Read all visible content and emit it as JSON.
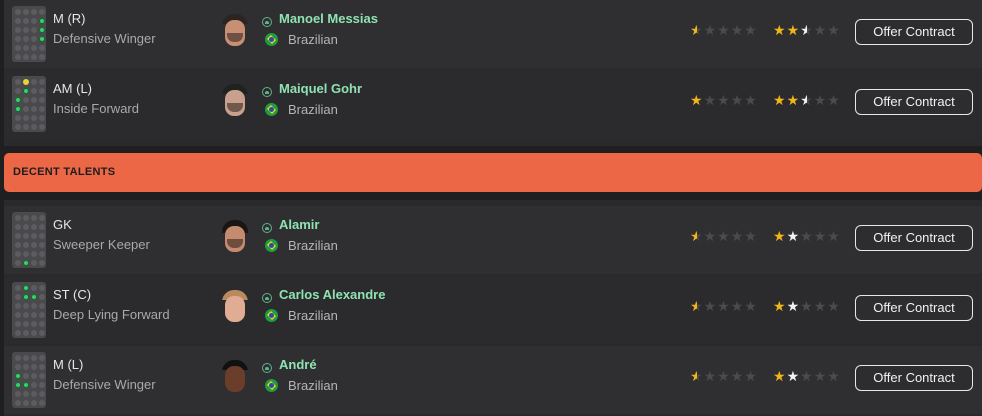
{
  "section_top_rows": [
    {
      "position": "M (R)",
      "role": "Defensive Winger",
      "name": "Manoel Messias",
      "nationality": "Brazilian",
      "current_ability_stars": 0.5,
      "potential_ability_stars": 2.5,
      "button": "Offer Contract"
    },
    {
      "position": "AM (L)",
      "role": "Inside Forward",
      "name": "Maiquel Gohr",
      "nationality": "Brazilian",
      "current_ability_stars": 1,
      "potential_ability_stars": 2.5,
      "button": "Offer Contract"
    }
  ],
  "banner": {
    "label": "DECENT TALENTS",
    "color": "#ec6746"
  },
  "section_decent_rows": [
    {
      "position": "GK",
      "role": "Sweeper Keeper",
      "name": "Alamir",
      "nationality": "Brazilian",
      "current_ability_stars": 0.5,
      "potential_ability_stars": 2,
      "button": "Offer Contract"
    },
    {
      "position": "ST (C)",
      "role": "Deep Lying Forward",
      "name": "Carlos Alexandre",
      "nationality": "Brazilian",
      "current_ability_stars": 0.5,
      "potential_ability_stars": 2,
      "button": "Offer Contract"
    },
    {
      "position": "M (L)",
      "role": "Defensive Winger",
      "name": "André",
      "nationality": "Brazilian",
      "current_ability_stars": 0.5,
      "potential_ability_stars": 2,
      "button": "Offer Contract"
    }
  ],
  "icons": {
    "agent": "agent-icon",
    "flag": "brazil-flag-icon",
    "pitch": "pitch-position-icon",
    "star": "star-icon"
  },
  "colors": {
    "name_green": "#8fe3b2",
    "star_gold": "#f2b619",
    "star_white": "#f1f1f1"
  }
}
